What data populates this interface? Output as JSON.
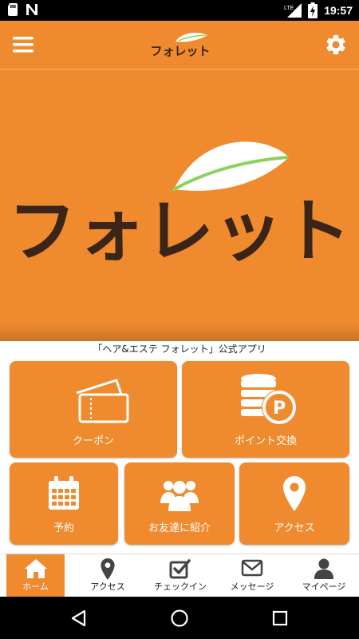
{
  "status_bar": {
    "time": "19:57",
    "network": "LTE",
    "icons": [
      "sd-card-icon",
      "n-notification-icon",
      "lte-signal-icon",
      "battery-charging-icon"
    ]
  },
  "app_bar": {
    "brand_logo": "フォレット",
    "icons": [
      "menu-icon",
      "gear-icon"
    ]
  },
  "hero": {
    "logo_text": "フォレット",
    "icon": "leaf-icon"
  },
  "caption": "「ヘア&エステ フォレット」公式アプリ",
  "tiles": [
    {
      "label": "クーポン",
      "icon": "coupon-ticket-icon"
    },
    {
      "label": "ポイント交換",
      "icon": "coin-point-icon"
    },
    {
      "label": "予約",
      "icon": "calendar-icon"
    },
    {
      "label": "お友達に紹介",
      "icon": "people-group-icon"
    },
    {
      "label": "アクセス",
      "icon": "map-pin-icon"
    }
  ],
  "bottom_nav": [
    {
      "label": "ホーム",
      "icon": "home-icon",
      "active": true
    },
    {
      "label": "アクセス",
      "icon": "map-pin-icon",
      "active": false
    },
    {
      "label": "チェックイン",
      "icon": "checkbox-icon",
      "active": false
    },
    {
      "label": "メッセージ",
      "icon": "envelope-icon",
      "active": false
    },
    {
      "label": "マイページ",
      "icon": "user-icon",
      "active": false
    }
  ],
  "system_nav": [
    "back-icon",
    "home-circle-icon",
    "recents-icon"
  ],
  "colors": {
    "accent": "#ef8a2e",
    "logo_dark": "#3b2418",
    "leaf_green": "#8fd15a",
    "white": "#ffffff"
  }
}
